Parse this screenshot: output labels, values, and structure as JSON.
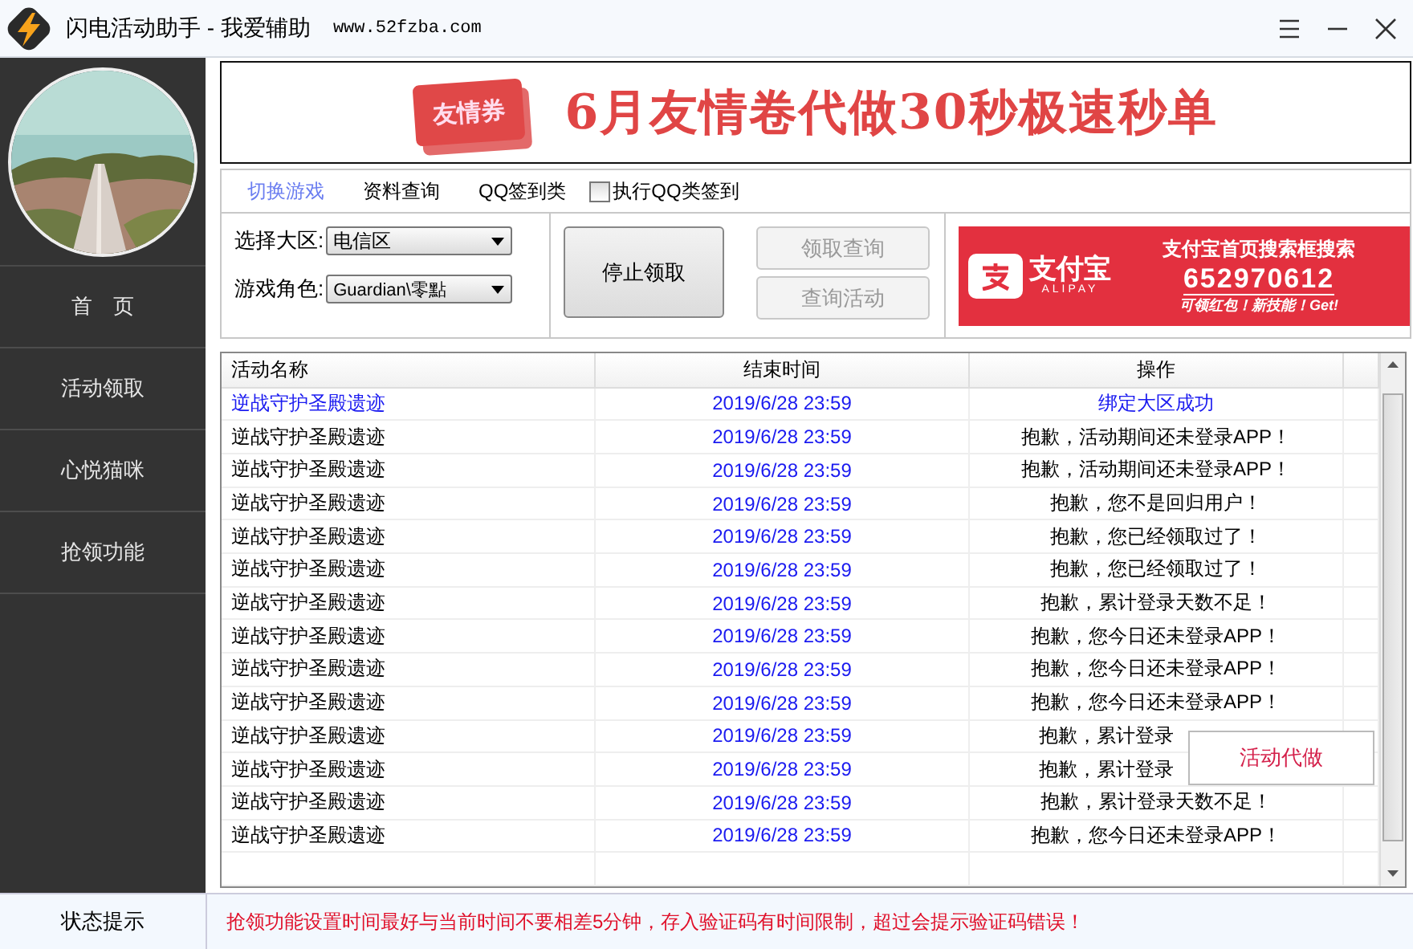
{
  "window": {
    "title": "闪电活动助手 - 我爱辅助",
    "url": "www.52fzba.com"
  },
  "sidebar": {
    "items": [
      {
        "label": "首　页"
      },
      {
        "label": "活动领取"
      },
      {
        "label": "心悦猫咪"
      },
      {
        "label": "抢领功能"
      }
    ]
  },
  "banner": {
    "ticket": "友情券",
    "headline": "6月友情卷代做30秒极速秒单"
  },
  "tabs": [
    {
      "label": "切换游戏",
      "selected": true
    },
    {
      "label": "资料查询",
      "selected": false
    },
    {
      "label": "QQ签到类",
      "selected": false
    }
  ],
  "qq_checkbox": {
    "label": "执行QQ类签到",
    "checked": false
  },
  "region": {
    "label": "选择大区:",
    "value": "电信区"
  },
  "role": {
    "label": "游戏角色:",
    "value": "Guardian\\零點"
  },
  "buttons": [
    {
      "label": "停止领取",
      "disabled": false
    },
    {
      "label": "领取查询",
      "disabled": true
    },
    {
      "label": "查询活动",
      "disabled": true
    }
  ],
  "ad": {
    "brand": "支付宝",
    "brand_en": "ALIPAY",
    "line1": "支付宝首页搜索框搜索",
    "number": "652970612",
    "line2": "可领红包！新技能！Get!"
  },
  "table": {
    "columns": [
      "活动名称",
      "结束时间",
      "操作"
    ],
    "rows": [
      {
        "name": "逆战守护圣殿遗迹",
        "end": "2019/6/28 23:59",
        "result": "绑定大区成功",
        "success": true,
        "covered": false
      },
      {
        "name": "逆战守护圣殿遗迹",
        "end": "2019/6/28 23:59",
        "result": "抱歉，活动期间还未登录APP！",
        "success": false,
        "covered": false
      },
      {
        "name": "逆战守护圣殿遗迹",
        "end": "2019/6/28 23:59",
        "result": "抱歉，活动期间还未登录APP！",
        "success": false,
        "covered": false
      },
      {
        "name": "逆战守护圣殿遗迹",
        "end": "2019/6/28 23:59",
        "result": "抱歉，您不是回归用户！",
        "success": false,
        "covered": false
      },
      {
        "name": "逆战守护圣殿遗迹",
        "end": "2019/6/28 23:59",
        "result": "抱歉，您已经领取过了！",
        "success": false,
        "covered": false
      },
      {
        "name": "逆战守护圣殿遗迹",
        "end": "2019/6/28 23:59",
        "result": "抱歉，您已经领取过了！",
        "success": false,
        "covered": false
      },
      {
        "name": "逆战守护圣殿遗迹",
        "end": "2019/6/28 23:59",
        "result": "抱歉，累计登录天数不足！",
        "success": false,
        "covered": false
      },
      {
        "name": "逆战守护圣殿遗迹",
        "end": "2019/6/28 23:59",
        "result": "抱歉，您今日还未登录APP！",
        "success": false,
        "covered": false
      },
      {
        "name": "逆战守护圣殿遗迹",
        "end": "2019/6/28 23:59",
        "result": "抱歉，您今日还未登录APP！",
        "success": false,
        "covered": false
      },
      {
        "name": "逆战守护圣殿遗迹",
        "end": "2019/6/28 23:59",
        "result": "抱歉，您今日还未登录APP！",
        "success": false,
        "covered": false
      },
      {
        "name": "逆战守护圣殿遗迹",
        "end": "2019/6/28 23:59",
        "result": "抱歉，累计登录",
        "success": false,
        "covered": true
      },
      {
        "name": "逆战守护圣殿遗迹",
        "end": "2019/6/28 23:59",
        "result": "抱歉，累计登录",
        "success": false,
        "covered": true
      },
      {
        "name": "逆战守护圣殿遗迹",
        "end": "2019/6/28 23:59",
        "result": "抱歉，累计登录天数不足！",
        "success": false,
        "covered": false
      },
      {
        "name": "逆战守护圣殿遗迹",
        "end": "2019/6/28 23:59",
        "result": "抱歉，您今日还未登录APP！",
        "success": false,
        "covered": false
      }
    ]
  },
  "popup": {
    "label": "活动代做"
  },
  "status_bar": {
    "label": "状态提示",
    "message": "抢领功能设置时间最好与当前时间不要相差5分钟，存入验证码有时间限制，超过会提示验证码错误！"
  }
}
